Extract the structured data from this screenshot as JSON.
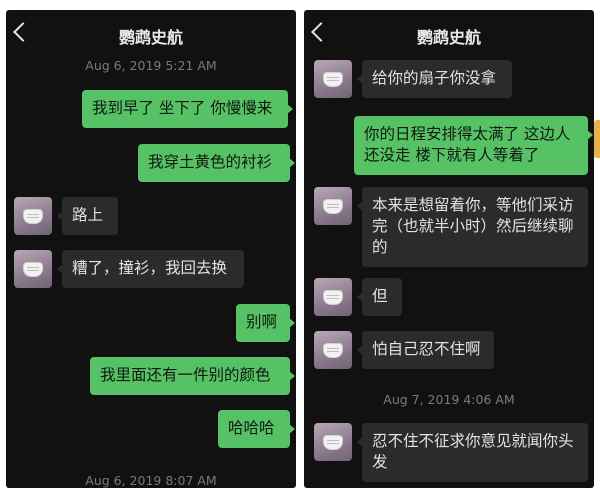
{
  "left": {
    "title": "鹦鹉史航",
    "timestamp_top": "Aug 6, 2019 5:21 AM",
    "timestamp_bottom": "Aug 6, 2019 8:07 AM",
    "messages": [
      {
        "side": "me",
        "text": "我到早了 坐下了 你慢慢来"
      },
      {
        "side": "me",
        "text": "我穿土黄色的衬衫"
      },
      {
        "side": "other",
        "text": "路上"
      },
      {
        "side": "other",
        "text": "糟了，撞衫，我回去换"
      },
      {
        "side": "me",
        "text": "别啊"
      },
      {
        "side": "me",
        "text": "我里面还有一件别的颜色"
      },
      {
        "side": "me",
        "text": "哈哈哈"
      }
    ]
  },
  "right": {
    "title": "鹦鹉史航",
    "timestamp_mid": "Aug 7, 2019 4:06 AM",
    "messages": [
      {
        "side": "other",
        "text": "给你的扇子你没拿"
      },
      {
        "side": "me",
        "text": "你的日程安排得太满了 这边人还没走 楼下就有人等着了"
      },
      {
        "side": "other",
        "text": "本来是想留着你，等他们采访完（也就半小时）然后继续聊的"
      },
      {
        "side": "other",
        "text": "但"
      },
      {
        "side": "other",
        "text": "怕自己忍不住啊"
      },
      {
        "side": "other",
        "text": "忍不住不征求你意见就闻你头发"
      }
    ]
  },
  "icons": {
    "back": "chevron-left-icon",
    "avatar": "avatar-masked-face"
  },
  "colors": {
    "chat_background": "#111111",
    "my_bubble": "#57c265",
    "other_bubble": "#2b2b2b",
    "timestamp": "#7a7a7a"
  }
}
